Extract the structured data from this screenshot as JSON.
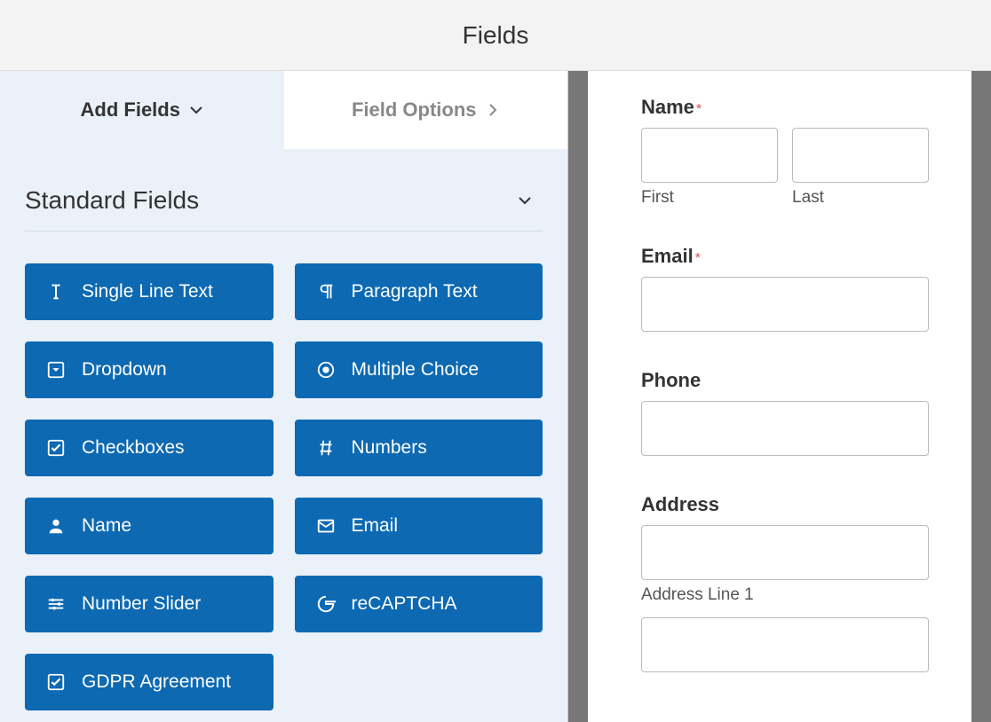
{
  "header": {
    "title": "Fields"
  },
  "tabs": {
    "add_fields": "Add Fields",
    "field_options": "Field Options"
  },
  "section": {
    "title": "Standard Fields"
  },
  "fields": [
    {
      "label": "Single Line Text",
      "icon": "text-cursor"
    },
    {
      "label": "Paragraph Text",
      "icon": "paragraph"
    },
    {
      "label": "Dropdown",
      "icon": "caret-square"
    },
    {
      "label": "Multiple Choice",
      "icon": "radio"
    },
    {
      "label": "Checkboxes",
      "icon": "check-square"
    },
    {
      "label": "Numbers",
      "icon": "hash"
    },
    {
      "label": "Name",
      "icon": "user"
    },
    {
      "label": "Email",
      "icon": "envelope"
    },
    {
      "label": "Number Slider",
      "icon": "sliders"
    },
    {
      "label": "reCAPTCHA",
      "icon": "google-g"
    },
    {
      "label": "GDPR Agreement",
      "icon": "check-square"
    }
  ],
  "preview": {
    "name_label": "Name",
    "first_sub": "First",
    "last_sub": "Last",
    "email_label": "Email",
    "phone_label": "Phone",
    "address_label": "Address",
    "address_line1_sub": "Address Line 1"
  }
}
